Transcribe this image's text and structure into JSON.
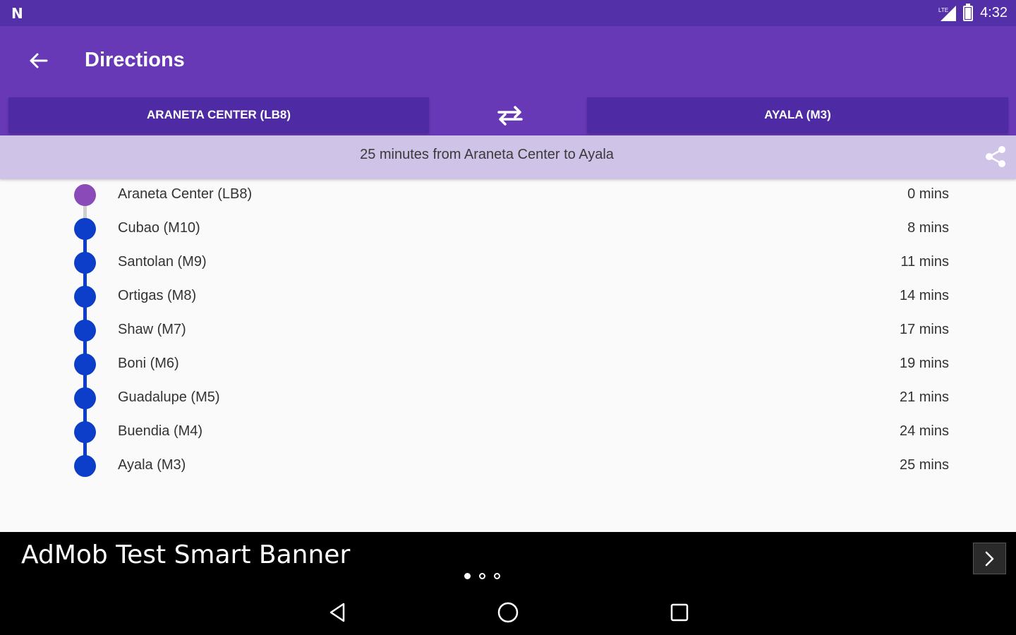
{
  "status_bar": {
    "time": "4:32",
    "network": "LTE"
  },
  "app_bar": {
    "title": "Directions"
  },
  "route_selector": {
    "from_label": "ARANETA CENTER (LB8)",
    "to_label": "AYALA (M3)"
  },
  "summary": {
    "text": "25 minutes from Araneta Center to Ayala"
  },
  "stations": [
    {
      "name": "Araneta Center (LB8)",
      "time": "0 mins"
    },
    {
      "name": "Cubao (M10)",
      "time": "8 mins"
    },
    {
      "name": "Santolan (M9)",
      "time": "11 mins"
    },
    {
      "name": "Ortigas (M8)",
      "time": "14 mins"
    },
    {
      "name": "Shaw (M7)",
      "time": "17 mins"
    },
    {
      "name": "Boni (M6)",
      "time": "19 mins"
    },
    {
      "name": "Guadalupe (M5)",
      "time": "21 mins"
    },
    {
      "name": "Buendia (M4)",
      "time": "24 mins"
    },
    {
      "name": "Ayala (M3)",
      "time": "25 mins"
    }
  ],
  "ad": {
    "text": "AdMob Test Smart Banner"
  },
  "colors": {
    "status_bar": "#5330a8",
    "app_bar": "#6739b6",
    "tab": "#4e2aa4",
    "summary_bar": "#d0c3e8",
    "line_blue": "#0d3ec9",
    "line_purple": "#8a4bb8"
  }
}
